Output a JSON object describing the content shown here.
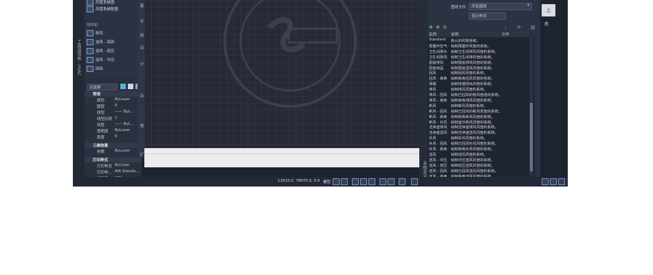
{
  "palette": {
    "vertical_label": "工具选项板 - HVAC",
    "items_top": [
      {
        "label": "风管系统图",
        "icon": "duct-icon"
      },
      {
        "label": "风管系统配图",
        "icon": "duct-icon"
      }
    ],
    "section": "排风机",
    "items": [
      {
        "label": "新风",
        "icon": "fan-icon"
      },
      {
        "label": "送风 - 回风",
        "icon": "fan-icon"
      },
      {
        "label": "送风 - 低压",
        "icon": "fan-icon"
      },
      {
        "label": "送风 - 中压",
        "icon": "fan-icon"
      },
      {
        "label": "回风",
        "icon": "fan-icon"
      }
    ],
    "side_tabs": [
      "基",
      "平",
      "组",
      "设",
      "计",
      "运",
      "维",
      "扩"
    ]
  },
  "properties": {
    "selector": "无选择",
    "sections": [
      {
        "title": "常规",
        "rows": [
          {
            "k": "颜色",
            "v": "ByLayer"
          },
          {
            "k": "图层",
            "v": "0"
          },
          {
            "k": "线型",
            "v": "—— ByL..."
          },
          {
            "k": "线型比例",
            "v": "1"
          },
          {
            "k": "线宽",
            "v": "—— ByL..."
          },
          {
            "k": "透明度",
            "v": "ByLayer"
          },
          {
            "k": "厚度",
            "v": "0"
          }
        ]
      },
      {
        "title": "三维效果",
        "rows": [
          {
            "k": "材质",
            "v": "ByLayer"
          }
        ]
      },
      {
        "title": "打印样式",
        "rows": [
          {
            "k": "打印样式",
            "v": "ByColor"
          },
          {
            "k": "打印样...",
            "v": "AIA Standa..."
          },
          {
            "k": "打印表...",
            "v": "模型"
          }
        ]
      }
    ]
  },
  "statusbar": {
    "coords": "12633.0, 78970.0, 0.0",
    "model_label": "模型"
  },
  "right_panel": {
    "filter_label": "图纸文件",
    "filter_value": "所有图纸",
    "style_dropdown": "显示样式",
    "vertical_label": "系统定义",
    "columns": [
      "名称",
      "说明",
      "文件"
    ],
    "rows": [
      {
        "n": "Standard",
        "d": "默认的风管系统。"
      },
      {
        "n": "再循环空气",
        "d": "绘制再循环风管的系统。"
      },
      {
        "n": "卫生间排水",
        "d": "绘制卫生间排风风管的系统。"
      },
      {
        "n": "卫生间排风",
        "d": "绘制卫生间排风管的系统。"
      },
      {
        "n": "厨房排风",
        "d": "绘制厨房排风风管的系统。"
      },
      {
        "n": "厨房用品",
        "d": "绘制厨房送风风管的系统。"
      },
      {
        "n": "回风",
        "d": "绘制回风风管的系统。"
      },
      {
        "n": "回风 - 高肯",
        "d": "绘制高肯回风风管的系统。"
      },
      {
        "n": "排烟",
        "d": "绘制排烟排出风管的系统。"
      },
      {
        "n": "排风",
        "d": "绘制排风风管的系统。"
      },
      {
        "n": "排风 - 回风",
        "d": "绘制已回风的排风管道的系统。"
      },
      {
        "n": "排风 - 高肯",
        "d": "绘制高肯排风风管的系统。"
      },
      {
        "n": "新风",
        "d": "绘制新风风管的系统。"
      },
      {
        "n": "新风 - 回风",
        "d": "绘制已回风的新风风管的系统。"
      },
      {
        "n": "新风 - 高肯",
        "d": "绘制高肯新风风管的系统。"
      },
      {
        "n": "新风 - 补风",
        "d": "绘制室外新风风管的系统。"
      },
      {
        "n": "洁净室排风",
        "d": "绘制洁净室排风风管的系统。"
      },
      {
        "n": "洁净室送风",
        "d": "绘制洁净室送风风管的系统。"
      },
      {
        "n": "补风",
        "d": "绘制补风风管的系统。"
      },
      {
        "n": "补风 - 回风",
        "d": "绘制已回风补风风管的系统。"
      },
      {
        "n": "补风 - 高肯",
        "d": "绘制高肯补风风管的系统。"
      },
      {
        "n": "送风",
        "d": "绘制送风风管的系统。"
      },
      {
        "n": "送风 - 中压",
        "d": "绘制中压送风风管的系统。"
      },
      {
        "n": "送风 - 低压",
        "d": "绘制低压送风风管的系统。"
      },
      {
        "n": "送风 - 回风",
        "d": "绘制已回风送风风管的系统。"
      },
      {
        "n": "送风 - 高肯",
        "d": "绘制高肯送风风管的系统。"
      }
    ]
  },
  "viewcube": {
    "face": "上",
    "south": "南"
  },
  "colors": {
    "bg": "#1e2330",
    "panel": "#2c3242",
    "accent": "#8fa4c7"
  }
}
